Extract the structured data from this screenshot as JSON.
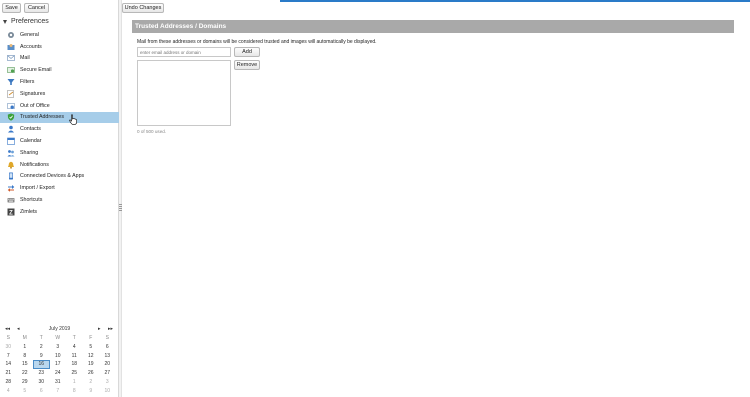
{
  "toolbar": {
    "save_label": "Save",
    "cancel_label": "Cancel",
    "undo_label": "Undo Changes"
  },
  "sidebar": {
    "header": "Preferences",
    "items": [
      {
        "label": "General",
        "icon": "gear-icon",
        "selected": false
      },
      {
        "label": "Accounts",
        "icon": "accounts-icon",
        "selected": false
      },
      {
        "label": "Mail",
        "icon": "mail-icon",
        "selected": false
      },
      {
        "label": "Secure Email",
        "icon": "secure-email-icon",
        "selected": false
      },
      {
        "label": "Filters",
        "icon": "filters-icon",
        "selected": false
      },
      {
        "label": "Signatures",
        "icon": "signature-icon",
        "selected": false
      },
      {
        "label": "Out of Office",
        "icon": "out-of-office-icon",
        "selected": false
      },
      {
        "label": "Trusted Addresses",
        "icon": "shield-icon",
        "selected": true
      },
      {
        "label": "Contacts",
        "icon": "contacts-icon",
        "selected": false
      },
      {
        "label": "Calendar",
        "icon": "calendar-icon",
        "selected": false
      },
      {
        "label": "Sharing",
        "icon": "sharing-icon",
        "selected": false
      },
      {
        "label": "Notifications",
        "icon": "bell-icon",
        "selected": false
      },
      {
        "label": "Connected Devices & Apps",
        "icon": "device-icon",
        "selected": false
      },
      {
        "label": "Import / Export",
        "icon": "import-export-icon",
        "selected": false
      },
      {
        "label": "Shortcuts",
        "icon": "keyboard-icon",
        "selected": false
      },
      {
        "label": "Zimlets",
        "icon": "zimlets-icon",
        "selected": false
      }
    ]
  },
  "calendar": {
    "month_label": "July 2019",
    "nav": {
      "prev_year": "◂◂",
      "prev_month": "◂",
      "next_month": "▸",
      "next_year": "▸▸"
    },
    "weekdays": [
      "S",
      "M",
      "T",
      "W",
      "T",
      "F",
      "S"
    ],
    "weeks": [
      [
        "30",
        "1",
        "2",
        "3",
        "4",
        "5",
        "6"
      ],
      [
        "7",
        "8",
        "9",
        "10",
        "11",
        "12",
        "13"
      ],
      [
        "14",
        "15",
        "16",
        "17",
        "18",
        "19",
        "20"
      ],
      [
        "21",
        "22",
        "23",
        "24",
        "25",
        "26",
        "27"
      ],
      [
        "28",
        "29",
        "30",
        "31",
        "1",
        "2",
        "3"
      ],
      [
        "4",
        "5",
        "6",
        "7",
        "8",
        "9",
        "10"
      ]
    ],
    "today": "16"
  },
  "main": {
    "section_title": "Trusted Addresses / Domains",
    "description": "Mail from these addresses or domains will be considered trusted and images will automatically be displayed.",
    "input_placeholder": "enter email address or domain",
    "add_label": "Add",
    "remove_label": "Remove",
    "usage_text": "0 of 500 used."
  },
  "colors": {
    "selected_bg": "#a6cde9",
    "section_bar": "#a9a9a9",
    "accent": "#2a7bc8"
  }
}
